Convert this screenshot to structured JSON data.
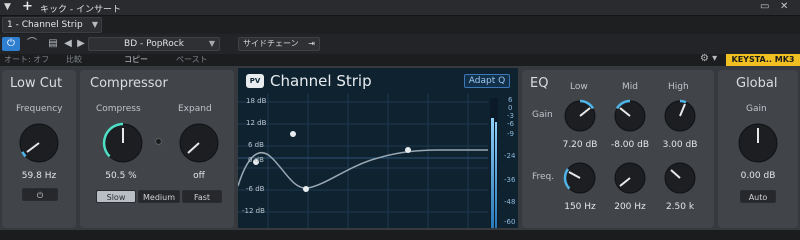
{
  "titlebar": {
    "title": "キック - インサート",
    "menu_icon": "triangle-down-icon",
    "add_icon": "plus-icon"
  },
  "channel_tab": {
    "label": "1 - Channel Strip"
  },
  "toolbar": {
    "preset_name": "BD - PopRock",
    "sidechain_label": "サイドチェーン",
    "auto_label": "オート: オフ",
    "compare_label": "比較",
    "copy_label": "コピー",
    "paste_label": "ペースト",
    "device_badge": "KEYSTA.. MK3",
    "accent": "#2f7fd1",
    "badge_color": "#f0c022"
  },
  "low_cut": {
    "title": "Low Cut",
    "label": "Frequency",
    "value": "59.8 Hz",
    "level": 0.22
  },
  "compressor": {
    "title": "Compressor",
    "compress_label": "Compress",
    "expand_label": "Expand",
    "compress_value": "50.5 %",
    "expand_value": "off",
    "compress_level": 0.5,
    "modes": [
      "Slow",
      "Medium",
      "Fast"
    ],
    "active_mode": "Slow"
  },
  "graph": {
    "title": "Channel Strip",
    "adapt_label": "Adapt Q",
    "db_labels": [
      "18 dB",
      "12 dB",
      "6 dB",
      "0 dB",
      "-6 dB",
      "-12 dB"
    ],
    "meter_labels": [
      "6",
      "0",
      "-3",
      "-6",
      "-9",
      "-24",
      "-36",
      "-48",
      "-60"
    ]
  },
  "eq": {
    "title": "EQ",
    "gain_label": "Gain",
    "freq_label": "Freq.",
    "bands": [
      {
        "name": "Low",
        "gain": "7.20 dB",
        "freq": "150 Hz"
      },
      {
        "name": "Mid",
        "gain": "-8.00 dB",
        "freq": "200 Hz"
      },
      {
        "name": "High",
        "gain": "3.00 dB",
        "freq": "2.50 k"
      }
    ]
  },
  "global": {
    "title": "Global",
    "label": "Gain",
    "value": "0.00 dB",
    "auto_label": "Auto"
  }
}
